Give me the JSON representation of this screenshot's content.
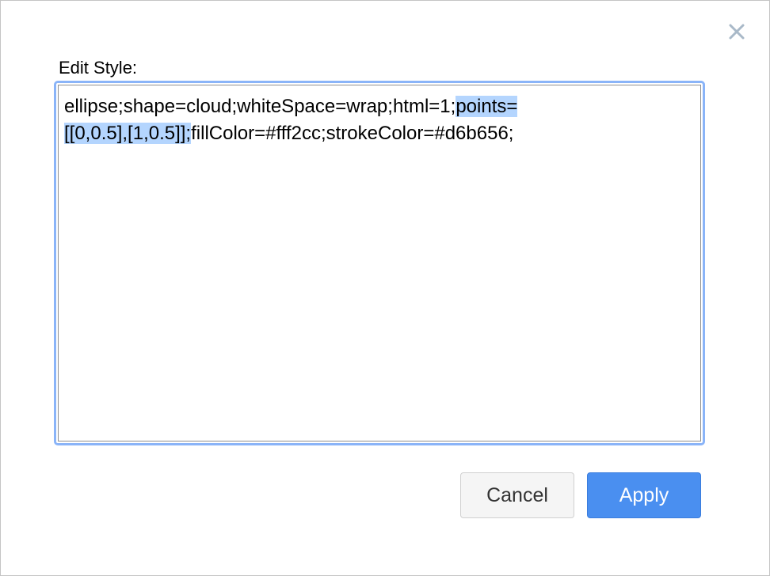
{
  "dialog": {
    "title": "Edit Style:",
    "close_icon": "close-x-icon",
    "style_text": {
      "line1_plain": "ellipse;shape=cloud;whiteSpace=wrap;html=1;",
      "line1_selected": "points=",
      "line2_selected": "[[0,0.5],[1,0.5]];",
      "line2_plain": "fillColor=#fff2cc;strokeColor=#d6b656;"
    },
    "buttons": {
      "cancel_label": "Cancel",
      "apply_label": "Apply"
    }
  },
  "colors": {
    "accent": "#4a8ff0",
    "focus_ring": "#8ab4f8",
    "selection": "#b4d5fe"
  }
}
